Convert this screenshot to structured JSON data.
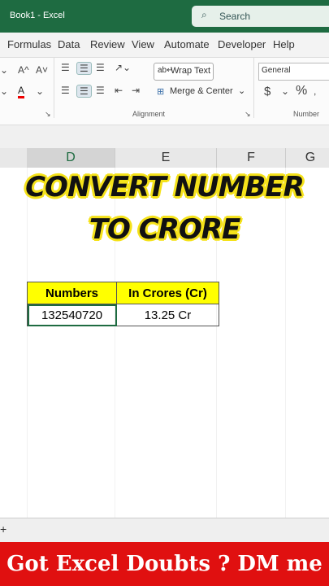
{
  "window": {
    "title": "Book1  -  Excel",
    "search_placeholder": "Search"
  },
  "menu": [
    "Formulas",
    "Data",
    "Review",
    "View",
    "Automate",
    "Developer",
    "Help"
  ],
  "ribbon": {
    "font_grow": "A^",
    "font_shrink": "A˅",
    "font_color": "A",
    "wrap_text": "Wrap Text",
    "merge_center": "Merge & Center",
    "number_format": "General",
    "currency": "$",
    "percent": "%",
    "group_alignment": "Alignment",
    "group_number": "Number"
  },
  "columns": [
    "D",
    "E",
    "F",
    "G"
  ],
  "overlay": {
    "line1": "CONVERT NUMBER",
    "line2": "TO CRORE"
  },
  "table": {
    "headers": [
      "Numbers",
      "In Crores (Cr)"
    ],
    "rows": [
      [
        "132540720",
        "13.25 Cr"
      ]
    ]
  },
  "sheet_add": "+",
  "footer": "Got Excel Doubts ? DM me",
  "colors": {
    "excel_green": "#1e6b41",
    "header_yellow": "#ffff00",
    "title_yellow": "#f5e21a",
    "footer_red": "#e01010"
  }
}
